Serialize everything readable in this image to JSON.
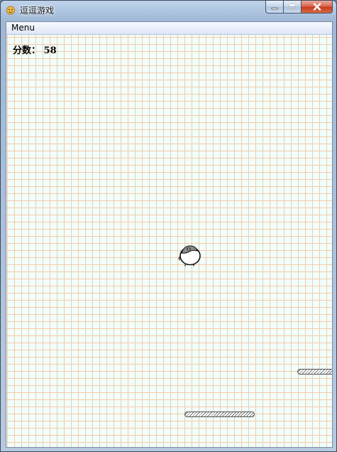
{
  "window": {
    "title": "逗逗游戏",
    "icon": "app-icon",
    "controls": [
      "minimize-icon",
      "maximize-icon",
      "close-icon"
    ]
  },
  "menubar": {
    "items": [
      {
        "label": "Menu"
      }
    ]
  },
  "game": {
    "score_label": "分数：",
    "score_value": "58",
    "character": "round-bird-character",
    "platform_count": 2,
    "background": "grid-paper",
    "grid_color": "#f6c9a6",
    "background_color": "#f0fffc"
  }
}
